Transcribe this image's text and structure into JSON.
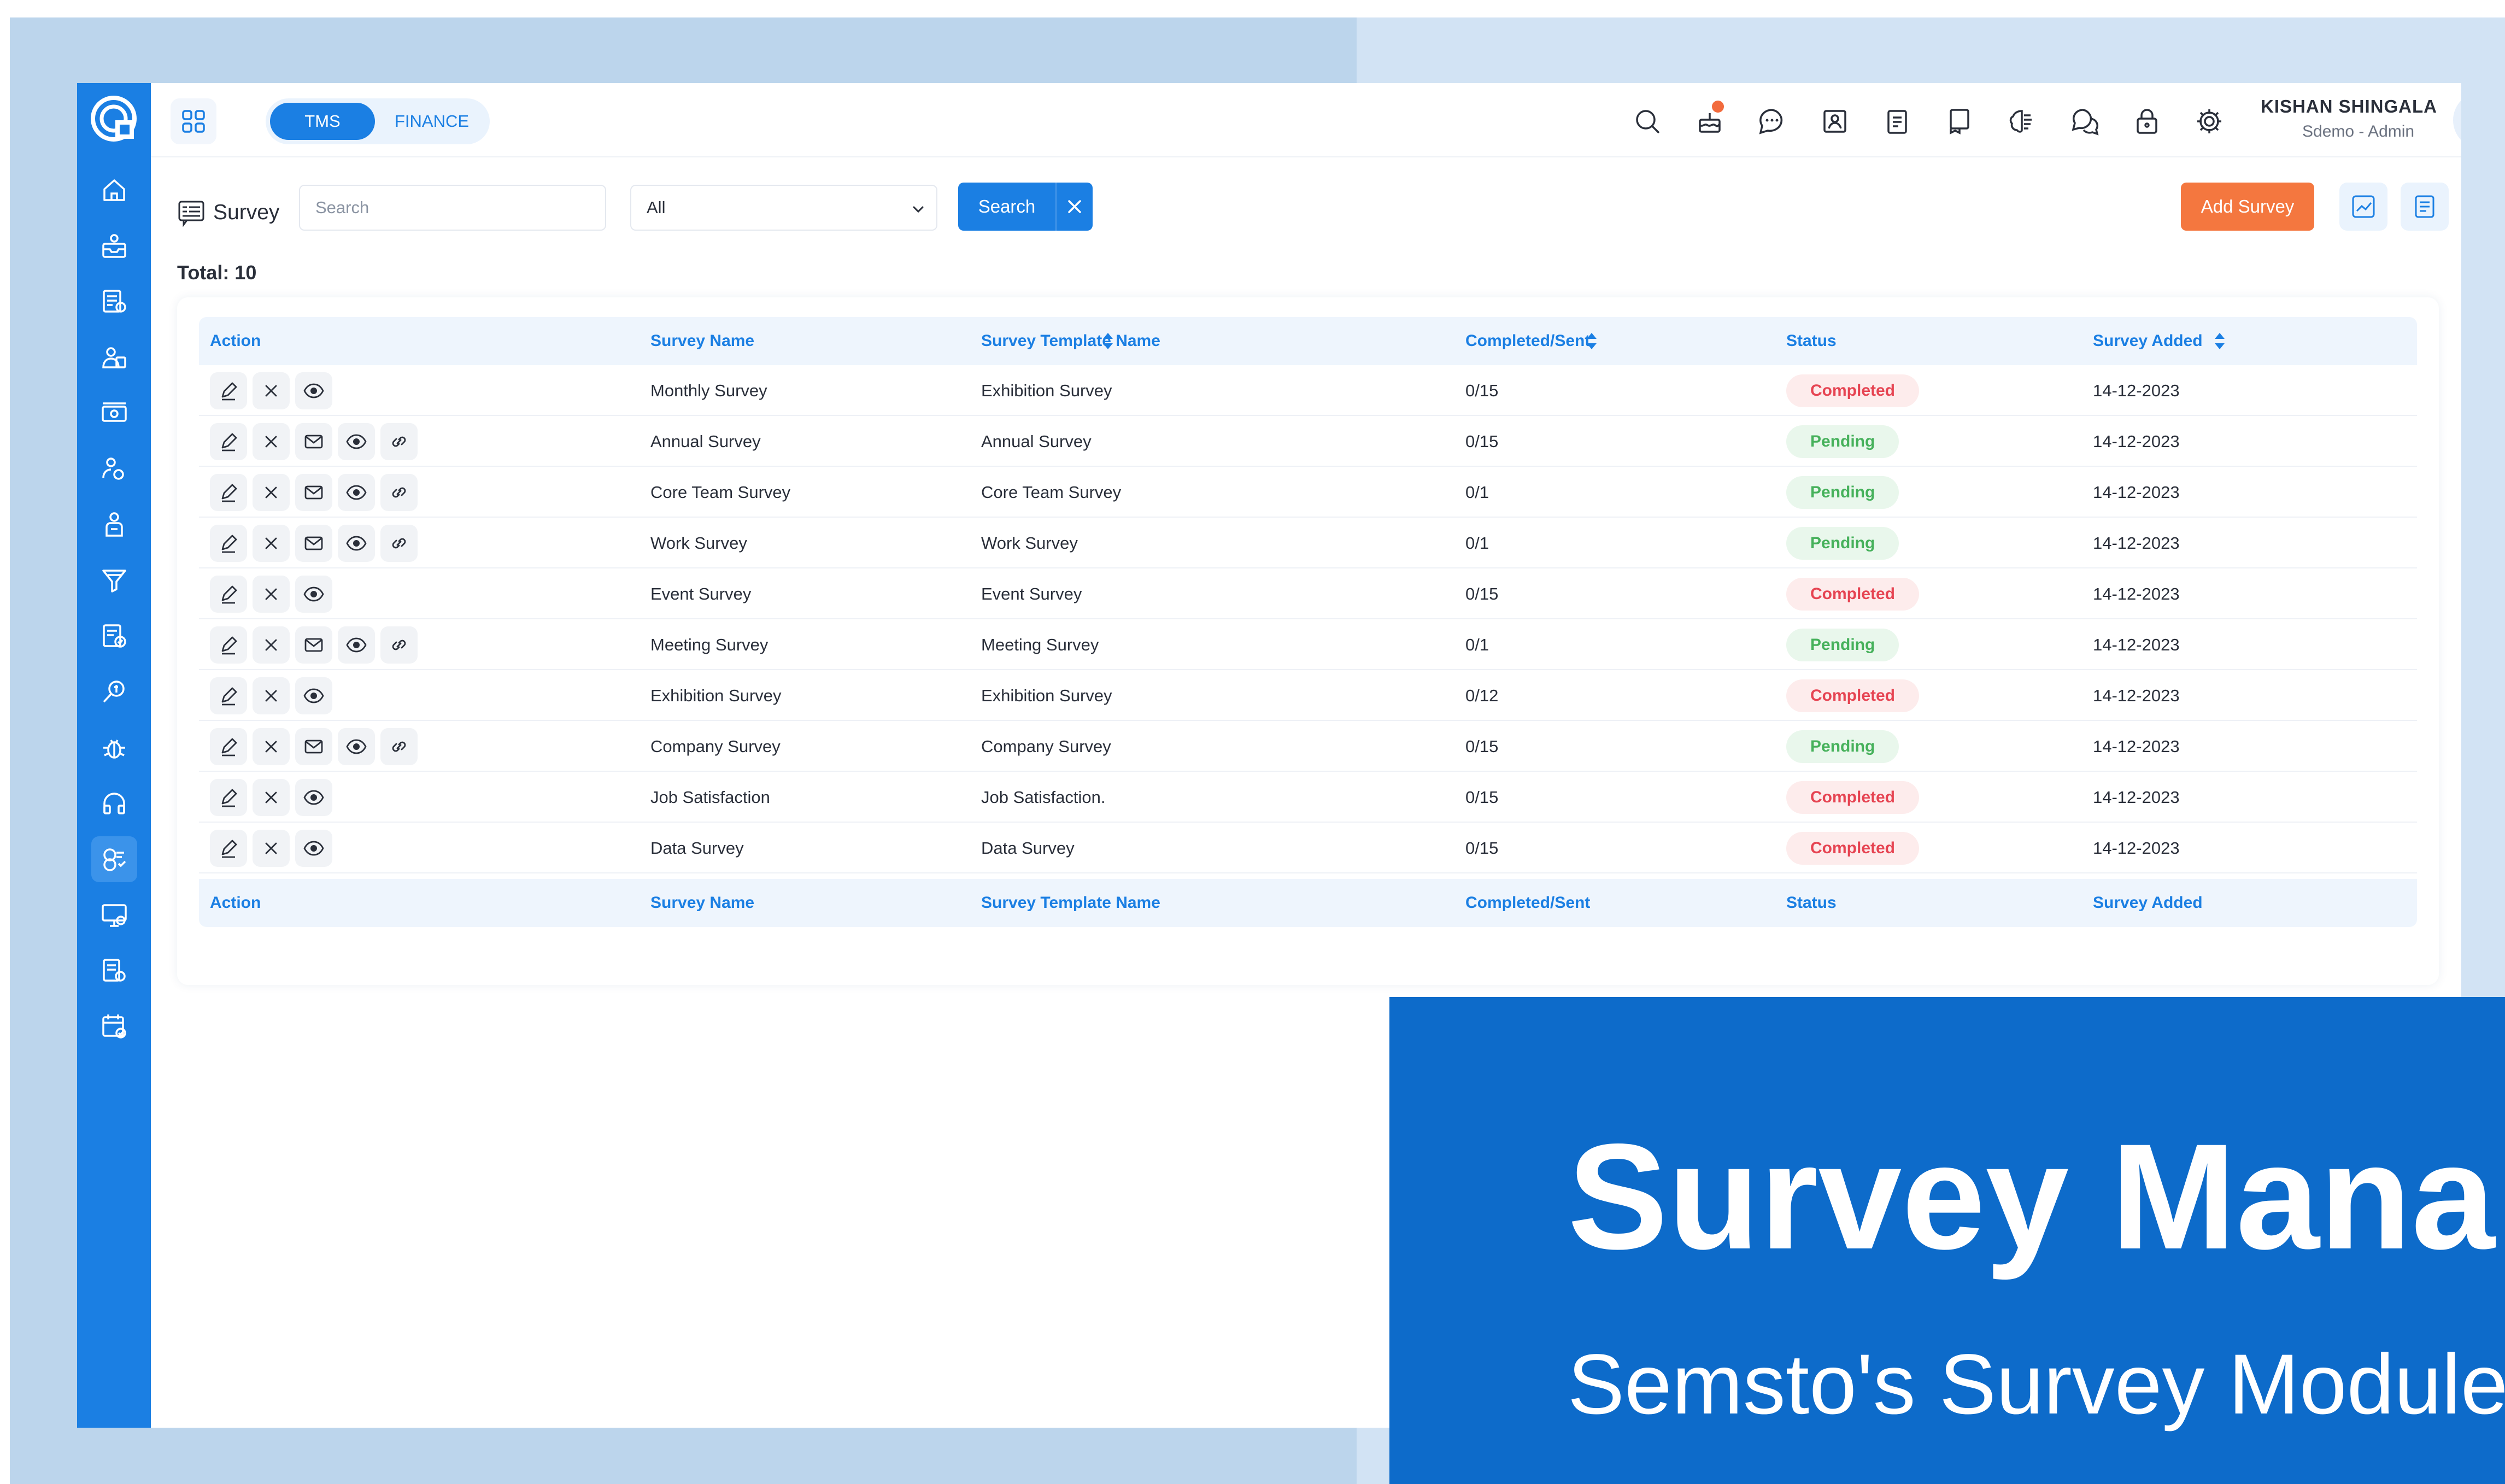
{
  "header": {
    "modules": [
      "TMS",
      "FINANCE"
    ],
    "active_module": "TMS",
    "user_name": "KISHAN SHINGALA",
    "user_role": "Sdemo - Admin",
    "icons": [
      "search-icon",
      "birthday-cake-icon",
      "chat-icon",
      "id-card-icon",
      "clipboard-icon",
      "book-icon",
      "brain-icon",
      "help-chat-icon",
      "lock-icon",
      "gear-icon"
    ]
  },
  "page": {
    "title": "Survey",
    "search_placeholder": "Search",
    "filter_value": "All",
    "search_button": "Search",
    "add_button": "Add Survey",
    "total": "Total: 10"
  },
  "table": {
    "headers": [
      "Action",
      "Survey Name",
      "Survey Template Name",
      "Completed/Sent",
      "Status",
      "Survey Added"
    ],
    "rows": [
      {
        "name": "Monthly Survey",
        "template": "Exhibition Survey",
        "completed": "0/15",
        "status": "Completed",
        "added": "14-12-2023",
        "actions": [
          "edit",
          "delete",
          "view"
        ]
      },
      {
        "name": "Annual Survey",
        "template": "Annual Survey",
        "completed": "0/15",
        "status": "Pending",
        "added": "14-12-2023",
        "actions": [
          "edit",
          "delete",
          "mail",
          "view",
          "link"
        ]
      },
      {
        "name": "Core Team Survey",
        "template": "Core Team Survey",
        "completed": "0/1",
        "status": "Pending",
        "added": "14-12-2023",
        "actions": [
          "edit",
          "delete",
          "mail",
          "view",
          "link"
        ]
      },
      {
        "name": "Work Survey",
        "template": "Work Survey",
        "completed": "0/1",
        "status": "Pending",
        "added": "14-12-2023",
        "actions": [
          "edit",
          "delete",
          "mail",
          "view",
          "link"
        ]
      },
      {
        "name": "Event Survey",
        "template": "Event Survey",
        "completed": "0/15",
        "status": "Completed",
        "added": "14-12-2023",
        "actions": [
          "edit",
          "delete",
          "view"
        ]
      },
      {
        "name": "Meeting Survey",
        "template": "Meeting Survey",
        "completed": "0/1",
        "status": "Pending",
        "added": "14-12-2023",
        "actions": [
          "edit",
          "delete",
          "mail",
          "view",
          "link"
        ]
      },
      {
        "name": "Exhibition Survey",
        "template": "Exhibition Survey",
        "completed": "0/12",
        "status": "Completed",
        "added": "14-12-2023",
        "actions": [
          "edit",
          "delete",
          "view"
        ]
      },
      {
        "name": "Company Survey",
        "template": "Company Survey",
        "completed": "0/15",
        "status": "Pending",
        "added": "14-12-2023",
        "actions": [
          "edit",
          "delete",
          "mail",
          "view",
          "link"
        ]
      },
      {
        "name": "Job Satisfaction",
        "template": "Job Satisfaction.",
        "completed": "0/15",
        "status": "Completed",
        "added": "14-12-2023",
        "actions": [
          "edit",
          "delete",
          "view"
        ]
      },
      {
        "name": "Data Survey",
        "template": "Data Survey",
        "completed": "0/15",
        "status": "Completed",
        "added": "14-12-2023",
        "actions": [
          "edit",
          "delete",
          "view"
        ]
      }
    ]
  },
  "banner": {
    "title": "Survey Mana",
    "subtitle": "Semsto's Survey Module"
  },
  "colors": {
    "primary": "#1b7fe3",
    "accent": "#f4773f",
    "completed": "#e64452",
    "pending": "#46b15b",
    "banner": "#0d6bca"
  }
}
